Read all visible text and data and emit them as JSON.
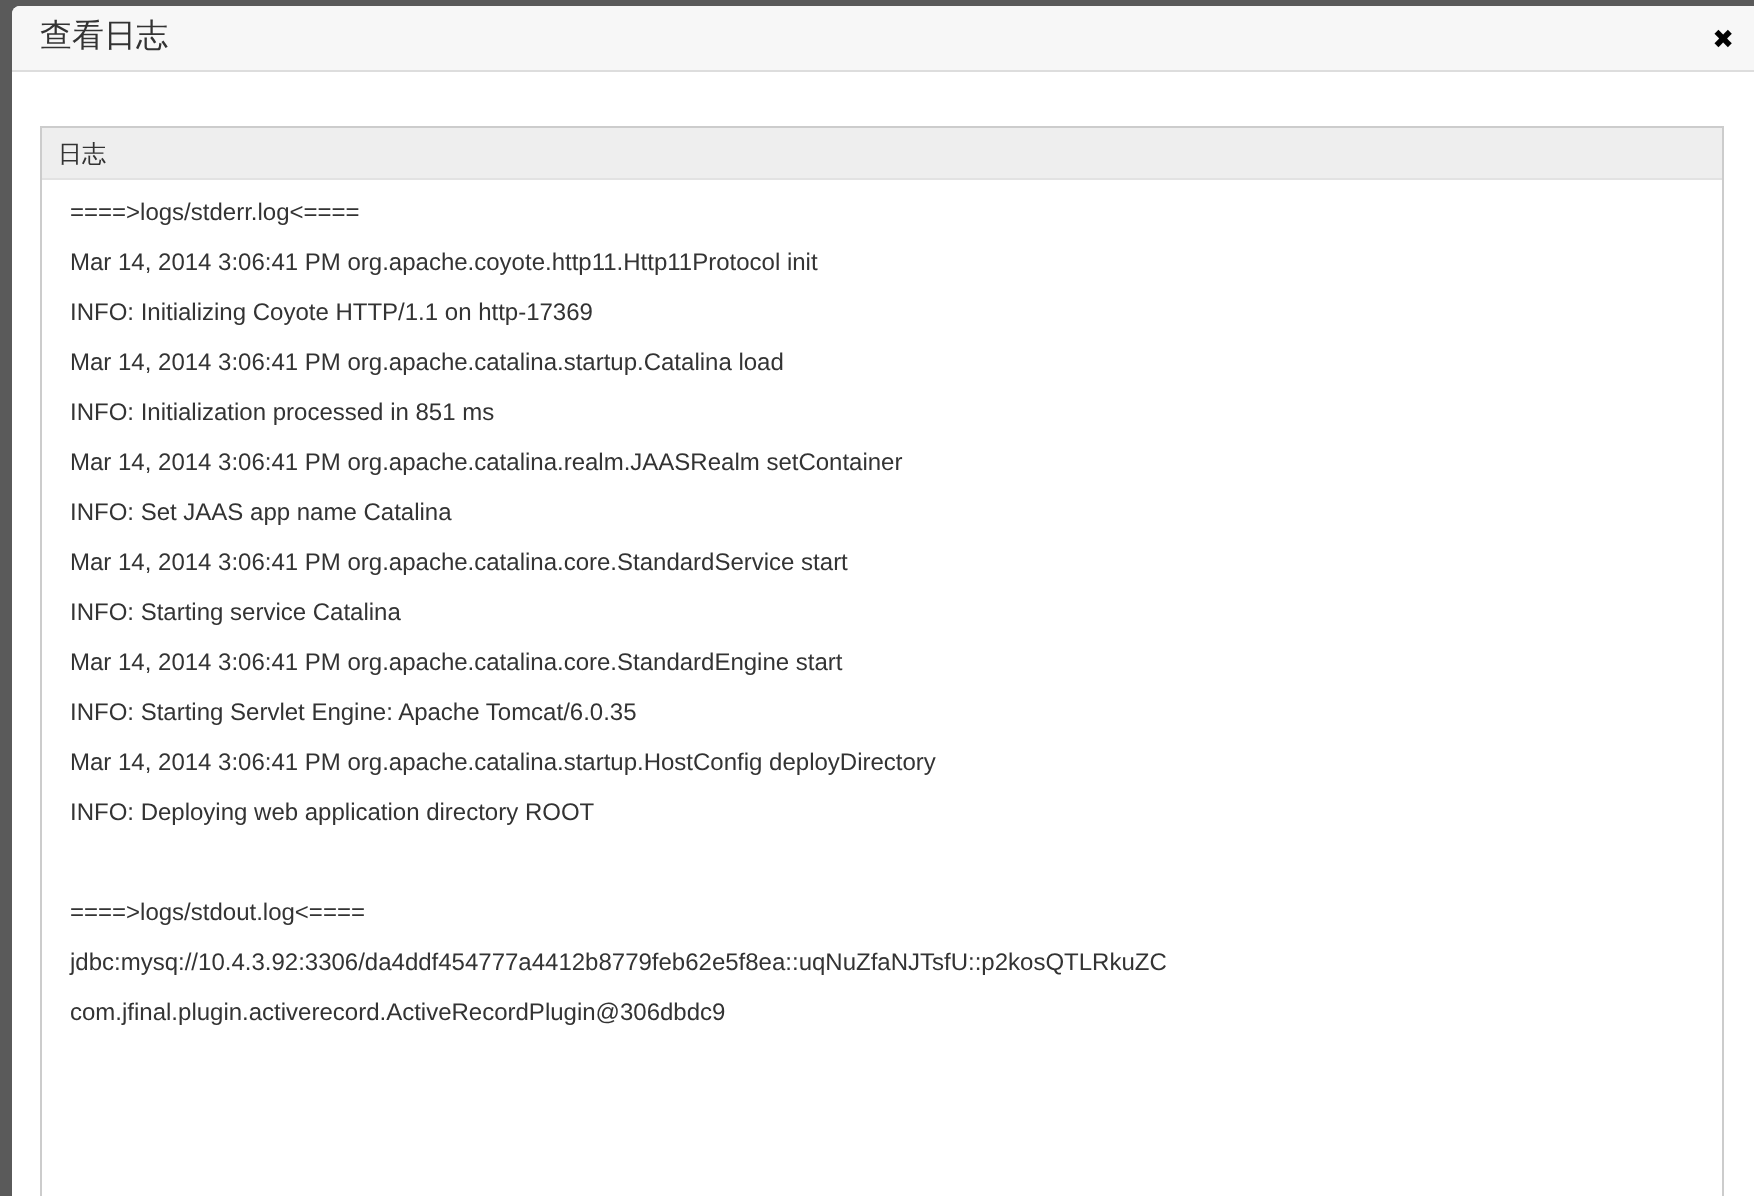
{
  "dialog": {
    "title": "查看日志",
    "close": "✖"
  },
  "panel": {
    "heading": "日志",
    "sections": [
      {
        "header": "====>logs/stderr.log<====",
        "lines": [
          "Mar 14, 2014 3:06:41 PM org.apache.coyote.http11.Http11Protocol init",
          "INFO: Initializing Coyote HTTP/1.1 on http-17369",
          "Mar 14, 2014 3:06:41 PM org.apache.catalina.startup.Catalina load",
          "INFO: Initialization processed in 851 ms",
          "Mar 14, 2014 3:06:41 PM org.apache.catalina.realm.JAASRealm setContainer",
          "INFO: Set JAAS app name Catalina",
          "Mar 14, 2014 3:06:41 PM org.apache.catalina.core.StandardService start",
          "INFO: Starting service Catalina",
          "Mar 14, 2014 3:06:41 PM org.apache.catalina.core.StandardEngine start",
          "INFO: Starting Servlet Engine: Apache Tomcat/6.0.35",
          "Mar 14, 2014 3:06:41 PM org.apache.catalina.startup.HostConfig deployDirectory",
          "INFO: Deploying web application directory ROOT"
        ]
      },
      {
        "header": "====>logs/stdout.log<====",
        "lines": [
          "jdbc:mysq://10.4.3.92:3306/da4ddf454777a4412b8779feb62e5f8ea::uqNuZfaNJTsfU::p2kosQTLRkuZC",
          "com.jfinal.plugin.activerecord.ActiveRecordPlugin@306dbdc9"
        ]
      }
    ]
  }
}
